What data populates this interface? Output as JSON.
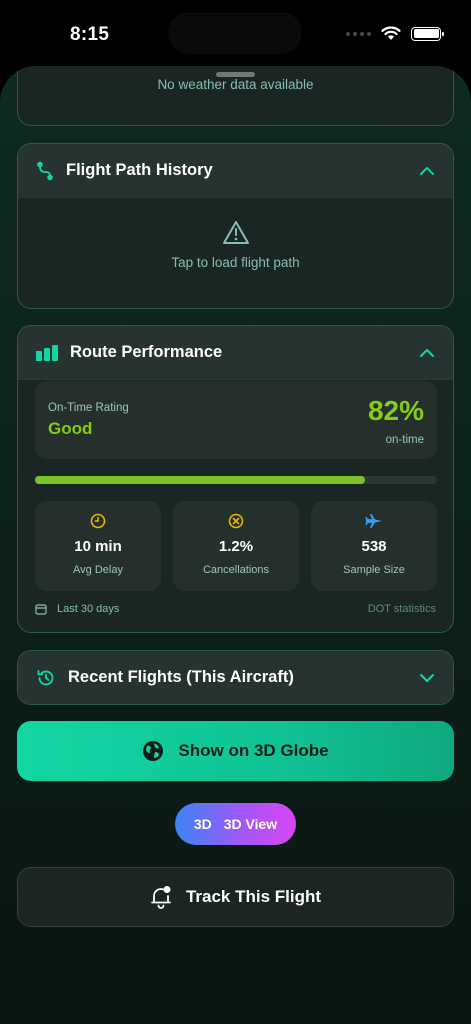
{
  "status_bar": {
    "time": "8:15"
  },
  "weather": {
    "message": "No weather data available"
  },
  "flight_path": {
    "title": "Flight Path History",
    "prompt": "Tap to load flight path"
  },
  "route_performance": {
    "title": "Route Performance",
    "rating_label": "On-Time Rating",
    "rating_value": "Good",
    "on_time_percent": "82%",
    "on_time_sub": "on-time",
    "progress_fraction": 0.82,
    "stats": [
      {
        "icon": "clock-icon",
        "value": "10 min",
        "label": "Avg Delay"
      },
      {
        "icon": "x-circle-icon",
        "value": "1.2%",
        "label": "Cancellations"
      },
      {
        "icon": "airplane-icon",
        "value": "538",
        "label": "Sample Size"
      }
    ],
    "period": "Last 30 days",
    "source": "DOT statistics"
  },
  "recent_flights": {
    "title": "Recent Flights (This Aircraft)"
  },
  "actions": {
    "globe_label": "Show on 3D Globe",
    "view3d_badge": "3D",
    "view3d_label": "3D View",
    "track_label": "Track This Flight"
  },
  "colors": {
    "accent_green": "#84cc16",
    "primary_teal": "#12d6a3",
    "card_border": "#2d5a4a"
  }
}
